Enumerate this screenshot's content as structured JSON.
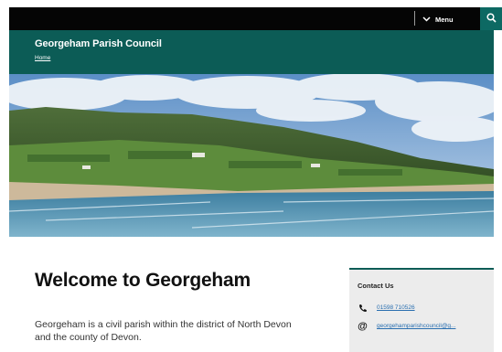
{
  "topbar": {
    "menu_label": "Menu",
    "menu_icon": "chevron-down-icon",
    "search_icon": "search-icon"
  },
  "header": {
    "title": "Georgeham Parish Council",
    "breadcrumb": "Home"
  },
  "hero": {
    "alt": "Coastal beach view with green hills"
  },
  "main": {
    "heading": "Welcome to Georgeham",
    "intro": "Georgeham is a civil parish within the district of North Devon and the county of Devon."
  },
  "contact": {
    "title": "Contact Us",
    "phone": "01598 710526",
    "email": "georgehamparishcouncil@g...",
    "phone_icon": "phone-icon",
    "email_icon": "at-sign-icon"
  },
  "colors": {
    "header_teal": "#0c5c56",
    "topbar": "#050505",
    "search_teal": "#0d6963",
    "link": "#2a6fb0"
  }
}
